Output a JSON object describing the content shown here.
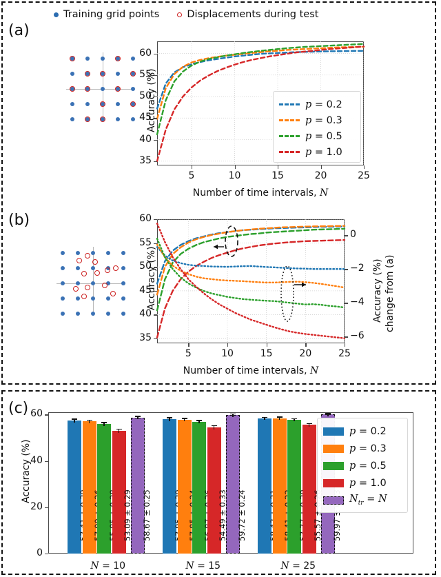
{
  "figure": {
    "panel_a_label": "(a)",
    "panel_b_label": "(b)",
    "panel_c_label": "(c)"
  },
  "top_legend": {
    "items": [
      {
        "marker": "filled-blue-dot",
        "label": "Training grid points",
        "color": "#2b6cb0"
      },
      {
        "marker": "open-red-circle",
        "label": "Displacements during test",
        "color": "#cc2020"
      }
    ]
  },
  "colors": {
    "p02": "#1f77b4",
    "p03": "#ff7f0e",
    "p05": "#2ca02c",
    "p10": "#d62728",
    "ntr": "#9467bd",
    "grid_dot": "#3b72b5",
    "disp_circle": "#cc2222",
    "axis": "#4b4b4b"
  },
  "chart_data": [
    {
      "id": "panel-a",
      "type": "line",
      "title": "",
      "xlabel": "Number of time intervals, N",
      "ylabel": "Accuracy (%)",
      "xlim": [
        1,
        25
      ],
      "ylim": [
        34,
        62.8
      ],
      "xticks": [
        5,
        10,
        15,
        20,
        25
      ],
      "yticks": [
        35,
        40,
        45,
        50,
        55,
        60
      ],
      "grid": true,
      "legend_position": "lower right",
      "linestyle": "dashed",
      "x": [
        1,
        2,
        3,
        4,
        5,
        6,
        7,
        8,
        9,
        10,
        11,
        12,
        13,
        14,
        15,
        16,
        17,
        18,
        19,
        20,
        21,
        22,
        23,
        24,
        25
      ],
      "series": [
        {
          "name": "p = 0.2",
          "color": "#1f77b4",
          "values": [
            47.2,
            53.0,
            55.6,
            56.8,
            57.5,
            58.0,
            58.4,
            58.7,
            59.0,
            59.3,
            59.5,
            59.7,
            59.9,
            60.0,
            60.1,
            60.2,
            60.3,
            60.35,
            60.4,
            60.45,
            60.5,
            60.52,
            60.55,
            60.58,
            60.6
          ]
        },
        {
          "name": "p = 0.3",
          "color": "#ff7f0e",
          "values": [
            44.8,
            51.9,
            55.2,
            56.9,
            57.9,
            58.5,
            58.9,
            59.2,
            59.5,
            59.7,
            59.9,
            60.1,
            60.3,
            60.5,
            60.6,
            60.8,
            60.9,
            61.0,
            61.1,
            61.2,
            61.3,
            61.4,
            61.45,
            61.5,
            61.55
          ]
        },
        {
          "name": "p = 0.5",
          "color": "#2ca02c",
          "values": [
            41.2,
            49.1,
            53.5,
            55.8,
            57.2,
            58.1,
            58.7,
            59.1,
            59.5,
            59.8,
            60.1,
            60.35,
            60.6,
            60.8,
            61.0,
            61.2,
            61.35,
            61.5,
            61.6,
            61.7,
            61.8,
            61.9,
            62.0,
            62.1,
            62.2
          ]
        },
        {
          "name": "p = 1.0",
          "color": "#d62728",
          "values": [
            35.0,
            42.3,
            47.0,
            50.0,
            52.1,
            53.7,
            54.9,
            55.9,
            56.7,
            57.4,
            58.0,
            58.5,
            58.9,
            59.3,
            59.6,
            59.9,
            60.2,
            60.4,
            60.6,
            60.8,
            61.0,
            61.15,
            61.3,
            61.45,
            61.6
          ]
        }
      ]
    },
    {
      "id": "panel-b",
      "type": "line",
      "title": "",
      "xlabel": "Number of time intervals, N",
      "ylabel": "Accuracy (%)",
      "ylabel_right": "Accuracy (%) change from (a)",
      "xlim": [
        1,
        25
      ],
      "ylim": [
        34,
        60
      ],
      "ylim_right": [
        -6.4,
        0.95
      ],
      "xticks": [
        5,
        10,
        15,
        20,
        25
      ],
      "yticks": [
        35,
        40,
        45,
        50,
        55,
        60
      ],
      "yticks_right": [
        0,
        -2,
        -4,
        -6
      ],
      "grid": true,
      "annotations": [
        {
          "kind": "dashed-ellipse-left-arrow",
          "refers_to": "dashed curves -> left axis"
        },
        {
          "kind": "dotted-ellipse-right-arrow",
          "refers_to": "dotted curves -> right axis"
        }
      ],
      "x": [
        1,
        2,
        3,
        4,
        5,
        6,
        7,
        8,
        9,
        10,
        11,
        12,
        13,
        14,
        15,
        16,
        17,
        18,
        19,
        20,
        21,
        22,
        23,
        24,
        25
      ],
      "series_dashed_left_axis": [
        {
          "name": "p = 0.2",
          "color": "#1f77b4",
          "values": [
            46.5,
            51.2,
            53.4,
            54.6,
            55.4,
            56.0,
            56.4,
            56.8,
            57.1,
            57.3,
            57.5,
            57.7,
            57.8,
            57.9,
            58.0,
            58.1,
            58.15,
            58.2,
            58.25,
            58.3,
            58.35,
            58.4,
            58.42,
            58.45,
            58.5
          ]
        },
        {
          "name": "p = 0.3",
          "color": "#ff7f0e",
          "values": [
            44.2,
            50.0,
            52.7,
            54.1,
            55.1,
            55.8,
            56.3,
            56.7,
            57.0,
            57.3,
            57.5,
            57.7,
            57.85,
            58.0,
            58.1,
            58.2,
            58.3,
            58.35,
            58.4,
            58.45,
            58.5,
            58.52,
            58.55,
            58.58,
            58.6
          ]
        },
        {
          "name": "p = 0.5",
          "color": "#2ca02c",
          "values": [
            40.9,
            47.4,
            50.9,
            52.7,
            53.8,
            54.6,
            55.2,
            55.6,
            56.0,
            56.3,
            56.5,
            56.7,
            56.9,
            57.0,
            57.2,
            57.3,
            57.4,
            57.5,
            57.6,
            57.7,
            57.8,
            57.85,
            57.9,
            57.95,
            58.0
          ]
        },
        {
          "name": "p = 1.0",
          "color": "#d62728",
          "values": [
            35.2,
            41.3,
            45.0,
            47.4,
            49.0,
            50.2,
            51.1,
            51.9,
            52.5,
            53.0,
            53.5,
            53.9,
            54.2,
            54.5,
            54.7,
            54.9,
            55.05,
            55.2,
            55.3,
            55.4,
            55.45,
            55.5,
            55.55,
            55.6,
            55.65
          ]
        }
      ],
      "series_dotted_right_axis": [
        {
          "name": "p = 0.2",
          "color": "#1f77b4",
          "values": [
            -0.7,
            -1.2,
            -1.5,
            -1.65,
            -1.75,
            -1.8,
            -1.82,
            -1.85,
            -1.86,
            -1.87,
            -1.85,
            -1.83,
            -1.82,
            -1.85,
            -1.88,
            -1.9,
            -1.93,
            -1.95,
            -1.97,
            -1.98,
            -2.0,
            -2.0,
            -2.0,
            -2.0,
            -2.0
          ]
        },
        {
          "name": "p = 0.3",
          "color": "#ff7f0e",
          "values": [
            -0.55,
            -1.3,
            -1.8,
            -2.1,
            -2.3,
            -2.45,
            -2.55,
            -2.6,
            -2.65,
            -2.68,
            -2.7,
            -2.72,
            -2.75,
            -2.78,
            -2.8,
            -2.8,
            -2.78,
            -2.76,
            -2.75,
            -2.78,
            -2.82,
            -2.88,
            -2.95,
            -3.02,
            -3.1
          ]
        },
        {
          "name": "p = 0.5",
          "color": "#2ca02c",
          "values": [
            -0.2,
            -1.3,
            -2.0,
            -2.5,
            -2.85,
            -3.1,
            -3.3,
            -3.45,
            -3.55,
            -3.65,
            -3.72,
            -3.78,
            -3.82,
            -3.85,
            -3.88,
            -3.9,
            -3.95,
            -4.0,
            -4.05,
            -4.1,
            -4.08,
            -4.12,
            -4.18,
            -4.22,
            -4.28
          ]
        },
        {
          "name": "p = 1.0",
          "color": "#d62728",
          "values": [
            0.7,
            -0.4,
            -1.3,
            -2.0,
            -2.6,
            -3.05,
            -3.45,
            -3.8,
            -4.1,
            -4.35,
            -4.6,
            -4.8,
            -5.0,
            -5.15,
            -5.3,
            -5.45,
            -5.58,
            -5.7,
            -5.78,
            -5.85,
            -5.9,
            -5.95,
            -6.0,
            -6.05,
            -6.1
          ]
        }
      ],
      "legend_position": "none"
    },
    {
      "id": "panel-c",
      "type": "bar",
      "title": "",
      "xlabel": "",
      "ylabel": "Accuracy (%)",
      "ylim": [
        0,
        61
      ],
      "yticks": [
        0,
        20,
        40,
        60
      ],
      "categories": [
        "N = 10",
        "N = 15",
        "N = 25"
      ],
      "legend_position": "right",
      "series": [
        {
          "name": "p = 0.2",
          "color": "#1f77b4",
          "values": [
            57.41,
            57.95,
            58.43
          ],
          "errors": [
            0.29,
            0.29,
            0.21
          ],
          "labels": [
            "57.41 ± 0.29",
            "57.95 ± 0.29",
            "58.43 ± 0.21"
          ]
        },
        {
          "name": "p = 0.3",
          "color": "#ff7f0e",
          "values": [
            57.0,
            57.85,
            58.41
          ],
          "errors": [
            0.26,
            0.24,
            0.22
          ],
          "labels": [
            "57.00 ± 0.26",
            "57.85 ± 0.24",
            "58.41 ± 0.22"
          ]
        },
        {
          "name": "p = 0.5",
          "color": "#2ca02c",
          "values": [
            55.85,
            56.87,
            57.77
          ],
          "errors": [
            0.28,
            0.26,
            0.2
          ],
          "labels": [
            "55.85 ± 0.28",
            "56.87 ± 0.26",
            "57.77 ± 0.20"
          ]
        },
        {
          "name": "p = 1.0",
          "color": "#d62728",
          "values": [
            53.09,
            54.49,
            55.57
          ],
          "errors": [
            0.29,
            0.33,
            0.26
          ],
          "labels": [
            "53.09 ± 0.29",
            "54.49 ± 0.33",
            "55.57 ± 0.26"
          ]
        },
        {
          "name": "Ntr = N",
          "color": "#9467bd",
          "values": [
            58.67,
            59.72,
            59.97
          ],
          "errors": [
            0.25,
            0.24,
            0.23
          ],
          "labels": [
            "58.67 ± 0.25",
            "59.72 ± 0.24",
            "59.97 ± 0.23"
          ],
          "edge": "dashed-black"
        }
      ]
    }
  ],
  "panel_a": {
    "xlabel": "Number of time intervals, N",
    "ylabel": "Accuracy (%)",
    "xticks": [
      "5",
      "10",
      "15",
      "20",
      "25"
    ],
    "yticks": [
      "35",
      "40",
      "45",
      "50",
      "55",
      "60"
    ],
    "legend": [
      "p = 0.2",
      "p = 0.3",
      "p = 0.5",
      "p = 1.0"
    ]
  },
  "panel_b": {
    "xlabel": "Number of time intervals, N",
    "ylabel": "Accuracy (%)",
    "ylabel_right_line1": "Accuracy (%)",
    "ylabel_right_line2": "change from (a)",
    "xticks": [
      "5",
      "10",
      "15",
      "20",
      "25"
    ],
    "yticks": [
      "35",
      "40",
      "45",
      "50",
      "55",
      "60"
    ],
    "yticks_right": [
      "0",
      "−2",
      "−4",
      "−6"
    ]
  },
  "panel_c": {
    "ylabel": "Accuracy (%)",
    "yticks": [
      "0",
      "20",
      "40",
      "60"
    ],
    "groups": [
      "N = 10",
      "N = 15",
      "N = 25"
    ],
    "legend": [
      "p = 0.2",
      "p = 0.3",
      "p = 0.5",
      "p = 1.0",
      "Ntr = N"
    ]
  }
}
